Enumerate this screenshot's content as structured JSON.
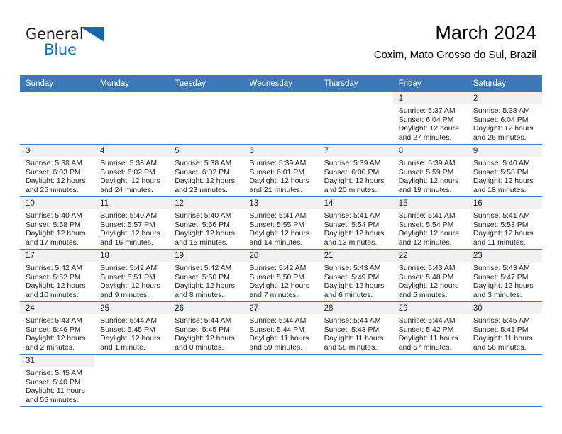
{
  "brand": {
    "name_top": "General",
    "name_bottom": "Blue",
    "accent_color": "#1368ad",
    "text_color": "#231f20"
  },
  "header": {
    "title": "March 2024",
    "subtitle": "Coxim, Mato Grosso do Sul, Brazil"
  },
  "theme": {
    "header_blue": "#3b79bb",
    "daynum_band": "#f0f0f0",
    "grid_line": "#3b79bb"
  },
  "weekdays": [
    "Sunday",
    "Monday",
    "Tuesday",
    "Wednesday",
    "Thursday",
    "Friday",
    "Saturday"
  ],
  "labels": {
    "sunrise_prefix": "Sunrise:",
    "sunset_prefix": "Sunset:",
    "daylight_prefix": "Daylight:"
  },
  "weeks": [
    [
      {
        "day": "",
        "blank": true
      },
      {
        "day": "",
        "blank": true
      },
      {
        "day": "",
        "blank": true
      },
      {
        "day": "",
        "blank": true
      },
      {
        "day": "",
        "blank": true
      },
      {
        "day": "1",
        "sunrise": "Sunrise: 5:37 AM",
        "sunset": "Sunset: 6:04 PM",
        "daylight_line1": "Daylight: 12 hours",
        "daylight_line2": "and 27 minutes."
      },
      {
        "day": "2",
        "sunrise": "Sunrise: 5:38 AM",
        "sunset": "Sunset: 6:04 PM",
        "daylight_line1": "Daylight: 12 hours",
        "daylight_line2": "and 26 minutes."
      }
    ],
    [
      {
        "day": "3",
        "sunrise": "Sunrise: 5:38 AM",
        "sunset": "Sunset: 6:03 PM",
        "daylight_line1": "Daylight: 12 hours",
        "daylight_line2": "and 25 minutes."
      },
      {
        "day": "4",
        "sunrise": "Sunrise: 5:38 AM",
        "sunset": "Sunset: 6:02 PM",
        "daylight_line1": "Daylight: 12 hours",
        "daylight_line2": "and 24 minutes."
      },
      {
        "day": "5",
        "sunrise": "Sunrise: 5:38 AM",
        "sunset": "Sunset: 6:02 PM",
        "daylight_line1": "Daylight: 12 hours",
        "daylight_line2": "and 23 minutes."
      },
      {
        "day": "6",
        "sunrise": "Sunrise: 5:39 AM",
        "sunset": "Sunset: 6:01 PM",
        "daylight_line1": "Daylight: 12 hours",
        "daylight_line2": "and 21 minutes."
      },
      {
        "day": "7",
        "sunrise": "Sunrise: 5:39 AM",
        "sunset": "Sunset: 6:00 PM",
        "daylight_line1": "Daylight: 12 hours",
        "daylight_line2": "and 20 minutes."
      },
      {
        "day": "8",
        "sunrise": "Sunrise: 5:39 AM",
        "sunset": "Sunset: 5:59 PM",
        "daylight_line1": "Daylight: 12 hours",
        "daylight_line2": "and 19 minutes."
      },
      {
        "day": "9",
        "sunrise": "Sunrise: 5:40 AM",
        "sunset": "Sunset: 5:58 PM",
        "daylight_line1": "Daylight: 12 hours",
        "daylight_line2": "and 18 minutes."
      }
    ],
    [
      {
        "day": "10",
        "sunrise": "Sunrise: 5:40 AM",
        "sunset": "Sunset: 5:58 PM",
        "daylight_line1": "Daylight: 12 hours",
        "daylight_line2": "and 17 minutes."
      },
      {
        "day": "11",
        "sunrise": "Sunrise: 5:40 AM",
        "sunset": "Sunset: 5:57 PM",
        "daylight_line1": "Daylight: 12 hours",
        "daylight_line2": "and 16 minutes."
      },
      {
        "day": "12",
        "sunrise": "Sunrise: 5:40 AM",
        "sunset": "Sunset: 5:56 PM",
        "daylight_line1": "Daylight: 12 hours",
        "daylight_line2": "and 15 minutes."
      },
      {
        "day": "13",
        "sunrise": "Sunrise: 5:41 AM",
        "sunset": "Sunset: 5:55 PM",
        "daylight_line1": "Daylight: 12 hours",
        "daylight_line2": "and 14 minutes."
      },
      {
        "day": "14",
        "sunrise": "Sunrise: 5:41 AM",
        "sunset": "Sunset: 5:54 PM",
        "daylight_line1": "Daylight: 12 hours",
        "daylight_line2": "and 13 minutes."
      },
      {
        "day": "15",
        "sunrise": "Sunrise: 5:41 AM",
        "sunset": "Sunset: 5:54 PM",
        "daylight_line1": "Daylight: 12 hours",
        "daylight_line2": "and 12 minutes."
      },
      {
        "day": "16",
        "sunrise": "Sunrise: 5:41 AM",
        "sunset": "Sunset: 5:53 PM",
        "daylight_line1": "Daylight: 12 hours",
        "daylight_line2": "and 11 minutes."
      }
    ],
    [
      {
        "day": "17",
        "sunrise": "Sunrise: 5:42 AM",
        "sunset": "Sunset: 5:52 PM",
        "daylight_line1": "Daylight: 12 hours",
        "daylight_line2": "and 10 minutes."
      },
      {
        "day": "18",
        "sunrise": "Sunrise: 5:42 AM",
        "sunset": "Sunset: 5:51 PM",
        "daylight_line1": "Daylight: 12 hours",
        "daylight_line2": "and 9 minutes."
      },
      {
        "day": "19",
        "sunrise": "Sunrise: 5:42 AM",
        "sunset": "Sunset: 5:50 PM",
        "daylight_line1": "Daylight: 12 hours",
        "daylight_line2": "and 8 minutes."
      },
      {
        "day": "20",
        "sunrise": "Sunrise: 5:42 AM",
        "sunset": "Sunset: 5:50 PM",
        "daylight_line1": "Daylight: 12 hours",
        "daylight_line2": "and 7 minutes."
      },
      {
        "day": "21",
        "sunrise": "Sunrise: 5:43 AM",
        "sunset": "Sunset: 5:49 PM",
        "daylight_line1": "Daylight: 12 hours",
        "daylight_line2": "and 6 minutes."
      },
      {
        "day": "22",
        "sunrise": "Sunrise: 5:43 AM",
        "sunset": "Sunset: 5:48 PM",
        "daylight_line1": "Daylight: 12 hours",
        "daylight_line2": "and 5 minutes."
      },
      {
        "day": "23",
        "sunrise": "Sunrise: 5:43 AM",
        "sunset": "Sunset: 5:47 PM",
        "daylight_line1": "Daylight: 12 hours",
        "daylight_line2": "and 3 minutes."
      }
    ],
    [
      {
        "day": "24",
        "sunrise": "Sunrise: 5:43 AM",
        "sunset": "Sunset: 5:46 PM",
        "daylight_line1": "Daylight: 12 hours",
        "daylight_line2": "and 2 minutes."
      },
      {
        "day": "25",
        "sunrise": "Sunrise: 5:44 AM",
        "sunset": "Sunset: 5:45 PM",
        "daylight_line1": "Daylight: 12 hours",
        "daylight_line2": "and 1 minute."
      },
      {
        "day": "26",
        "sunrise": "Sunrise: 5:44 AM",
        "sunset": "Sunset: 5:45 PM",
        "daylight_line1": "Daylight: 12 hours",
        "daylight_line2": "and 0 minutes."
      },
      {
        "day": "27",
        "sunrise": "Sunrise: 5:44 AM",
        "sunset": "Sunset: 5:44 PM",
        "daylight_line1": "Daylight: 11 hours",
        "daylight_line2": "and 59 minutes."
      },
      {
        "day": "28",
        "sunrise": "Sunrise: 5:44 AM",
        "sunset": "Sunset: 5:43 PM",
        "daylight_line1": "Daylight: 11 hours",
        "daylight_line2": "and 58 minutes."
      },
      {
        "day": "29",
        "sunrise": "Sunrise: 5:44 AM",
        "sunset": "Sunset: 5:42 PM",
        "daylight_line1": "Daylight: 11 hours",
        "daylight_line2": "and 57 minutes."
      },
      {
        "day": "30",
        "sunrise": "Sunrise: 5:45 AM",
        "sunset": "Sunset: 5:41 PM",
        "daylight_line1": "Daylight: 11 hours",
        "daylight_line2": "and 56 minutes."
      }
    ],
    [
      {
        "day": "31",
        "sunrise": "Sunrise: 5:45 AM",
        "sunset": "Sunset: 5:40 PM",
        "daylight_line1": "Daylight: 11 hours",
        "daylight_line2": "and 55 minutes."
      },
      {
        "day": "",
        "blank": true
      },
      {
        "day": "",
        "blank": true
      },
      {
        "day": "",
        "blank": true
      },
      {
        "day": "",
        "blank": true
      },
      {
        "day": "",
        "blank": true
      },
      {
        "day": "",
        "blank": true
      }
    ]
  ]
}
